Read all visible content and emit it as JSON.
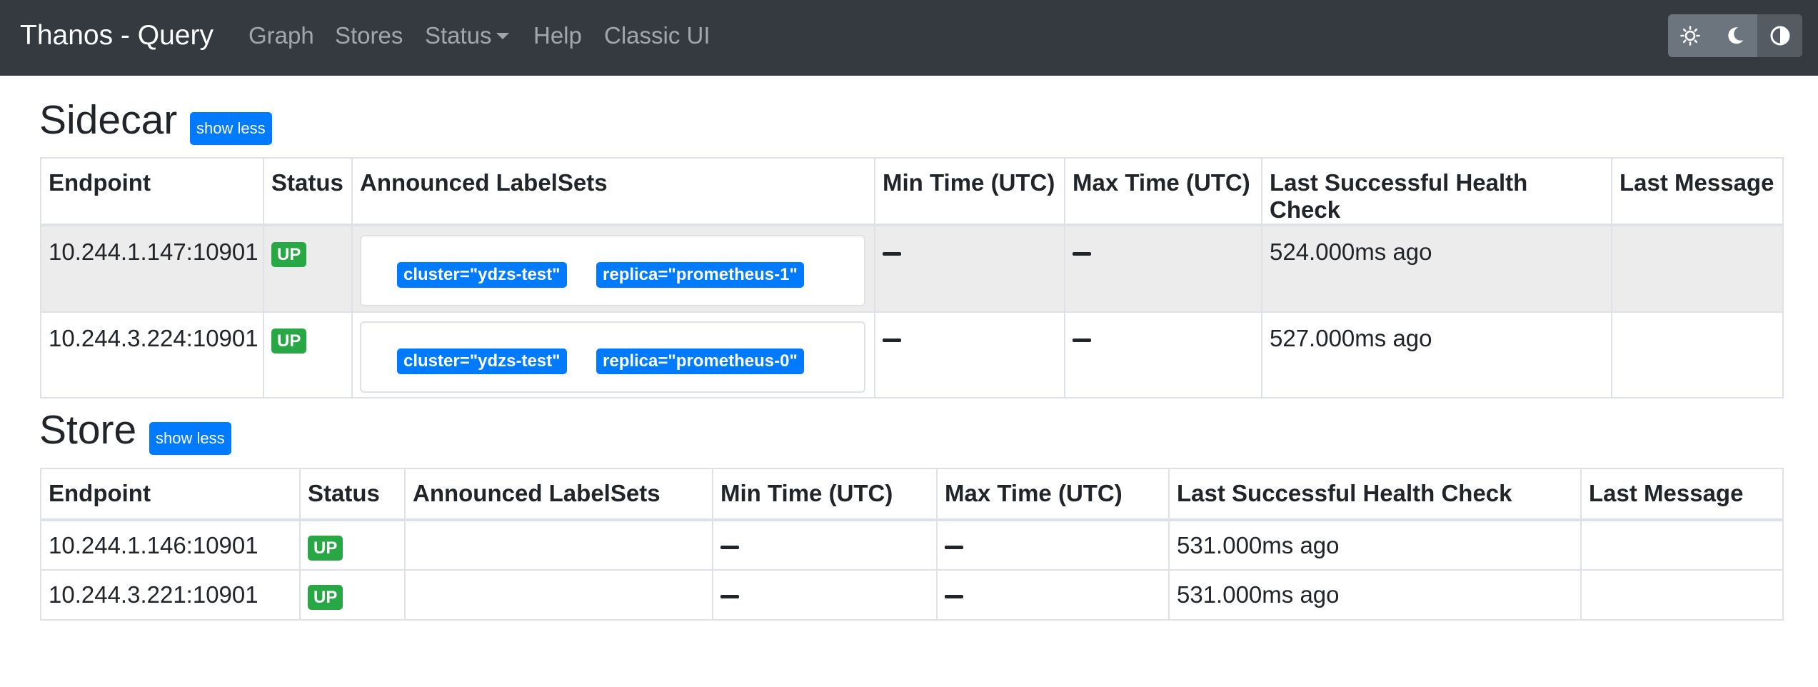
{
  "navbar": {
    "brand": "Thanos - Query",
    "links": [
      "Graph",
      "Stores",
      "Status",
      "Help",
      "Classic UI"
    ],
    "theme_buttons": [
      "light-theme",
      "dark-theme",
      "auto-theme"
    ]
  },
  "colors": {
    "navbar_bg": "#343a40",
    "primary": "#007bff",
    "success": "#28a745"
  },
  "sidecar": {
    "title": "Sidecar",
    "toggle_label": "show less",
    "columns": [
      "Endpoint",
      "Status",
      "Announced LabelSets",
      "Min Time (UTC)",
      "Max Time (UTC)",
      "Last Successful Health Check",
      "Last Message"
    ],
    "rows": [
      {
        "endpoint": "10.244.1.147:10901",
        "status": "UP",
        "labels": [
          "cluster=\"ydzs-test\"",
          "replica=\"prometheus-1\""
        ],
        "min_time": "",
        "max_time": "",
        "last_check": "524.000ms ago",
        "last_message": ""
      },
      {
        "endpoint": "10.244.3.224:10901",
        "status": "UP",
        "labels": [
          "cluster=\"ydzs-test\"",
          "replica=\"prometheus-0\""
        ],
        "min_time": "",
        "max_time": "",
        "last_check": "527.000ms ago",
        "last_message": ""
      }
    ]
  },
  "store": {
    "title": "Store",
    "toggle_label": "show less",
    "columns": [
      "Endpoint",
      "Status",
      "Announced LabelSets",
      "Min Time (UTC)",
      "Max Time (UTC)",
      "Last Successful Health Check",
      "Last Message"
    ],
    "rows": [
      {
        "endpoint": "10.244.1.146:10901",
        "status": "UP",
        "labels": [],
        "min_time": "",
        "max_time": "",
        "last_check": "531.000ms ago",
        "last_message": ""
      },
      {
        "endpoint": "10.244.3.221:10901",
        "status": "UP",
        "labels": [],
        "min_time": "",
        "max_time": "",
        "last_check": "531.000ms ago",
        "last_message": ""
      }
    ]
  }
}
